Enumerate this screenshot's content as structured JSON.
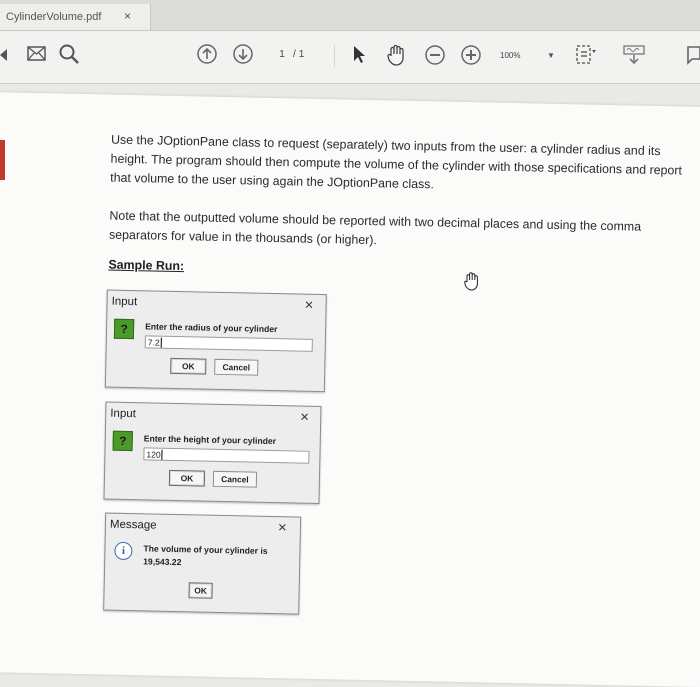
{
  "tab": {
    "title": "CylinderVolume.pdf",
    "close": "×"
  },
  "toolbar": {
    "page_current": "1",
    "page_separator": "/",
    "page_total": "1",
    "zoom": "100%",
    "icons": [
      "mail-icon",
      "search-icon",
      "page-up-icon",
      "page-down-icon",
      "select-arrow-icon",
      "hand-tool-icon",
      "zoom-out-icon",
      "zoom-in-icon",
      "fit-page-icon",
      "sign-icon",
      "comment-icon"
    ]
  },
  "document": {
    "paragraph1": "Use the JOptionPane class to request (separately) two inputs from the user: a cylinder radius and its height. The program should then compute the volume of the cylinder with those specifications and report that volume to the user using again the JOptionPane class.",
    "paragraph2": "Note that the outputted volume should be reported with two decimal places and using the comma separators for value in the thousands (or higher).",
    "sample_run": "Sample Run:"
  },
  "dialogs": {
    "radius": {
      "title": "Input",
      "close": "×",
      "icon": "?",
      "prompt": "Enter the radius of your cylinder",
      "value": "7.2",
      "ok": "OK",
      "cancel": "Cancel"
    },
    "height": {
      "title": "Input",
      "close": "×",
      "icon": "?",
      "prompt": "Enter the height of your cylinder",
      "value": "120",
      "ok": "OK",
      "cancel": "Cancel"
    },
    "message": {
      "title": "Message",
      "close": "×",
      "icon": "i",
      "line1": "The volume of your cylinder is",
      "line2": "19,543.22",
      "ok": "OK"
    }
  },
  "colors": {
    "question_icon": "#4c9a2a",
    "info_icon": "#2f5f9e",
    "page": "#fbfbfa"
  }
}
